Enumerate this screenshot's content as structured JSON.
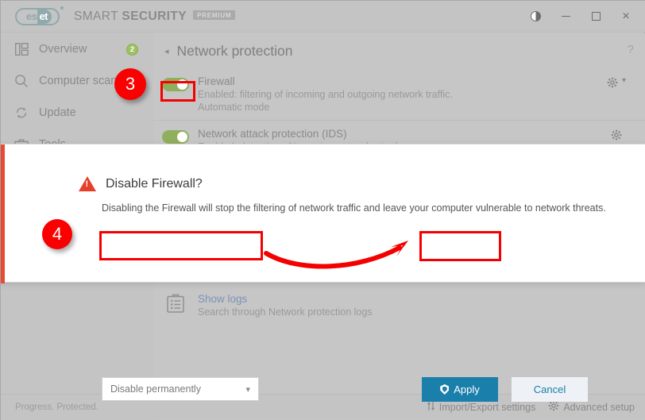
{
  "window": {
    "brand_light": "SMART ",
    "brand_bold": "SECURITY",
    "brand_edition": "PREMIUM",
    "logo_text_a": "es",
    "logo_text_b": "et",
    "controls": {
      "contrast_label": "contrast-toggle",
      "minimize_label": "minimize",
      "maximize_label": "maximize",
      "close_label": "×"
    }
  },
  "sidebar": {
    "items": [
      {
        "label": "Overview",
        "icon": "dashboard-icon",
        "badge": "2"
      },
      {
        "label": "Computer scan",
        "icon": "magnifier-icon",
        "badge": ""
      },
      {
        "label": "Update",
        "icon": "refresh-icon",
        "badge": ""
      },
      {
        "label": "Tools",
        "icon": "toolbox-icon",
        "badge": ""
      }
    ]
  },
  "page": {
    "back_arrow": "◂",
    "title": "Network protection",
    "help": "?"
  },
  "protection_rows": [
    {
      "name": "Firewall",
      "status": "Enabled: filtering of incoming and outgoing network traffic.",
      "mode": "Automatic mode",
      "toggle_state": "on",
      "has_chevron": true
    },
    {
      "name": "Network attack protection (IDS)",
      "status": "Enabled: detection of incoming network attacks.",
      "mode": "",
      "toggle_state": "on",
      "has_chevron": false
    }
  ],
  "logs": {
    "link": "Show logs",
    "desc": "Search through Network protection logs"
  },
  "dialog": {
    "title": "Disable Firewall?",
    "body": "Disabling the Firewall will stop the filtering of network traffic and leave your computer vulnerable to network threats.",
    "select_value": "Disable permanently",
    "select_chevron": "⌄",
    "apply_label": "Apply",
    "cancel_label": "Cancel"
  },
  "statusbar": {
    "progress": "Progress. Protected.",
    "import_export": "Import/Export settings",
    "advanced_setup": "Advanced setup"
  },
  "annotations": {
    "step3": "3",
    "step4": "4"
  },
  "colors": {
    "accent_blue": "#1b7fab",
    "annotation_red": "#fa0000",
    "dialog_accent": "#e84a33",
    "toggle_green": "#8faf5e",
    "badge_green": "#9cc162",
    "link_blue": "#7b93b8",
    "chrome_gray": "#c4c4c4"
  }
}
